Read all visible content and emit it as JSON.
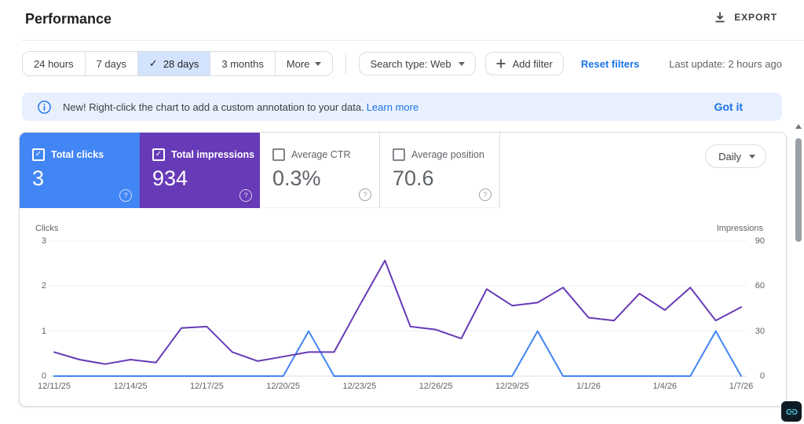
{
  "header": {
    "title": "Performance",
    "export_label": "EXPORT"
  },
  "toolbar": {
    "date_ranges": [
      {
        "label": "24 hours",
        "selected": false
      },
      {
        "label": "7 days",
        "selected": false
      },
      {
        "label": "28 days",
        "selected": true
      },
      {
        "label": "3 months",
        "selected": false
      },
      {
        "label": "More",
        "selected": false,
        "caret": true
      }
    ],
    "search_type_label": "Search type: Web",
    "add_filter_label": "Add filter",
    "reset_filters_label": "Reset filters",
    "last_update": "Last update: 2 hours ago"
  },
  "banner": {
    "message": "New! Right-click the chart to add a custom annotation to your data.",
    "link_label": "Learn more",
    "dismiss_label": "Got it"
  },
  "metrics": [
    {
      "label": "Total clicks",
      "value": "3",
      "checked": true,
      "style": "colored",
      "bg_color": "#4285f4"
    },
    {
      "label": "Total impressions",
      "value": "934",
      "checked": true,
      "style": "colored",
      "bg_color": "#673ab7"
    },
    {
      "label": "Average CTR",
      "value": "0.3%",
      "checked": false,
      "style": "plain",
      "bg_color": "#ffffff"
    },
    {
      "label": "Average position",
      "value": "70.6",
      "checked": false,
      "style": "plain",
      "bg_color": "#ffffff"
    }
  ],
  "granularity_label": "Daily",
  "chart_data": {
    "type": "line",
    "x": [
      "12/11/25",
      "12/12/25",
      "12/13/25",
      "12/14/25",
      "12/15/25",
      "12/16/25",
      "12/17/25",
      "12/18/25",
      "12/19/25",
      "12/20/25",
      "12/21/25",
      "12/22/25",
      "12/23/25",
      "12/24/25",
      "12/25/25",
      "12/26/25",
      "12/27/25",
      "12/28/25",
      "12/29/25",
      "12/30/25",
      "12/31/25",
      "1/1/26",
      "1/2/26",
      "1/3/26",
      "1/4/26",
      "1/5/26",
      "1/6/26",
      "1/7/26"
    ],
    "x_tick_every": 3,
    "left_axis": {
      "label": "Clicks",
      "ticks": [
        0,
        1,
        2,
        3
      ],
      "max": 3
    },
    "right_axis": {
      "label": "Impressions",
      "ticks": [
        0,
        30,
        60,
        90
      ],
      "max": 90
    },
    "series": [
      {
        "name": "Clicks",
        "axis": "left",
        "color": "#4285f4",
        "values": [
          0,
          0,
          0,
          0,
          0,
          0,
          0,
          0,
          0,
          0,
          1,
          0,
          0,
          0,
          0,
          0,
          0,
          0,
          0,
          1,
          0,
          0,
          0,
          0,
          0,
          0,
          1,
          0
        ]
      },
      {
        "name": "Impressions",
        "axis": "right",
        "color": "#673ab7",
        "values": [
          16,
          11,
          8,
          11,
          9,
          32,
          33,
          16,
          10,
          13,
          16,
          16,
          47,
          77,
          33,
          31,
          25,
          58,
          47,
          49,
          59,
          39,
          37,
          55,
          44,
          59,
          37,
          46
        ]
      }
    ],
    "grid": "horizontal",
    "legend": "none"
  },
  "icons": {
    "checkmark": "✓",
    "help_glyph": "?"
  },
  "colors": {
    "accent_blue": "#1a73e8",
    "selected_range_bg": "#d3e3fd",
    "banner_bg": "#e8f0fe",
    "border": "#dadce0",
    "gridline": "#eceff1",
    "baseline": "#dadce0",
    "text_secondary": "#5f6368"
  }
}
